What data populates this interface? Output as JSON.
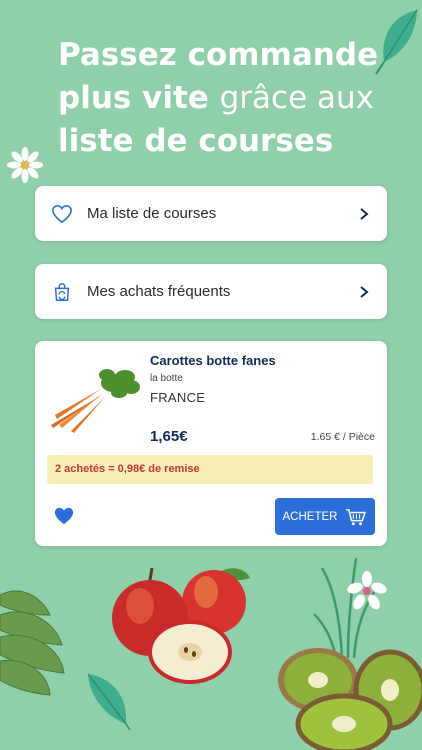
{
  "headline": {
    "line1": "Passez commande",
    "line2_bold": "plus vite ",
    "line2_light": "grâce aux",
    "line3": "liste de courses"
  },
  "lists": [
    {
      "label": "Ma liste de courses",
      "icon": "heart-icon"
    },
    {
      "label": "Mes achats fréquents",
      "icon": "bag-refresh-icon"
    }
  ],
  "product": {
    "name": "Carottes botte fanes",
    "unit": "la botte",
    "origin": "FRANCE",
    "price": "1,65€",
    "unit_price": "1.65 € / Pièce",
    "promo": "2 achetés = 0,98€ de remise",
    "buy_label": "ACHETER",
    "favorite": true
  },
  "colors": {
    "background": "#8fcfa9",
    "brand_blue": "#2d6fd9",
    "navy": "#0f2b5b",
    "promo_bg": "#f8efb7",
    "promo_text": "#c0392b"
  }
}
